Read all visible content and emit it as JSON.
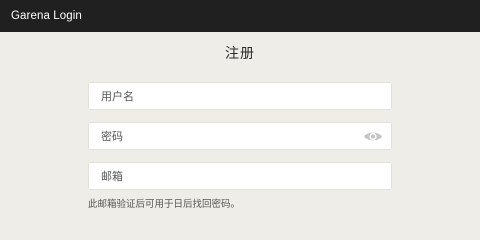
{
  "window": {
    "title": "Garena Login"
  },
  "form": {
    "heading": "注册",
    "username_placeholder": "用户名",
    "password_placeholder": "密码",
    "email_placeholder": "邮箱",
    "email_hint": "此邮箱验证后可用于日后找回密码。",
    "password_toggle_icon": "eye-icon"
  }
}
